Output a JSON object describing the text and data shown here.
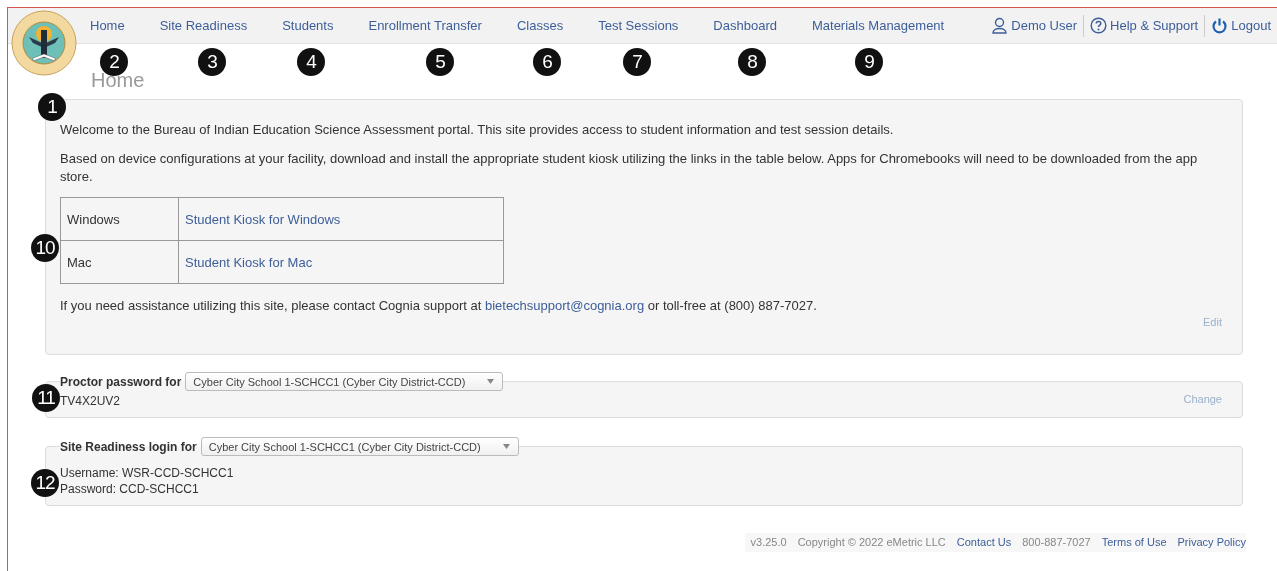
{
  "header": {
    "nav": [
      {
        "label": "Home"
      },
      {
        "label": "Site Readiness"
      },
      {
        "label": "Students"
      },
      {
        "label": "Enrollment Transfer"
      },
      {
        "label": "Classes"
      },
      {
        "label": "Test Sessions"
      },
      {
        "label": "Dashboard"
      },
      {
        "label": "Materials Management"
      }
    ],
    "user_links": [
      {
        "kind": "user",
        "label": "Demo User"
      },
      {
        "kind": "help",
        "label": "Help & Support"
      },
      {
        "kind": "logout",
        "label": "Logout"
      }
    ]
  },
  "page_title": "Home",
  "welcome_panel": {
    "paragraphs": [
      "Welcome to the Bureau of Indian Education Science Assessment portal. This site provides access to student information and test session details.",
      "Based on device configurations at your facility, download and install the appropriate student kiosk utilizing the links in the table below. Apps for Chromebooks will need to be downloaded from the app store."
    ],
    "kiosk_table": [
      {
        "platform": "Windows",
        "link": "Student Kiosk for Windows"
      },
      {
        "platform": "Mac",
        "link": "Student Kiosk for Mac"
      }
    ],
    "contact": {
      "before": "If you need assistance utilizing this site, please contact Cognia support at ",
      "email": "bietechsupport@cognia.org",
      "after": " or toll-free at (800) 887-7027."
    },
    "edit_link": "Edit"
  },
  "proctor_password": {
    "label": "Proctor password for",
    "school": "Cyber City School 1-SCHCC1 (Cyber City District-CCD)",
    "value": "TV4X2UV2",
    "change_link": "Change"
  },
  "site_readiness_login": {
    "label": "Site Readiness login for",
    "school": "Cyber City School 1-SCHCC1 (Cyber City District-CCD)",
    "lines": [
      "Username: WSR-CCD-SCHCC1",
      "Password: CCD-SCHCC1"
    ]
  },
  "footer": {
    "items": [
      {
        "kind": "text",
        "label": "v3.25.0"
      },
      {
        "kind": "text",
        "label": "Copyright © 2022 eMetric LLC"
      },
      {
        "kind": "link",
        "label": "Contact Us"
      },
      {
        "kind": "text",
        "label": "800-887-7027"
      },
      {
        "kind": "link",
        "label": "Terms of Use"
      },
      {
        "kind": "link",
        "label": "Privacy Policy"
      }
    ]
  },
  "callouts": [
    "1",
    "2",
    "3",
    "4",
    "5",
    "6",
    "7",
    "8",
    "9",
    "10",
    "11",
    "12"
  ]
}
